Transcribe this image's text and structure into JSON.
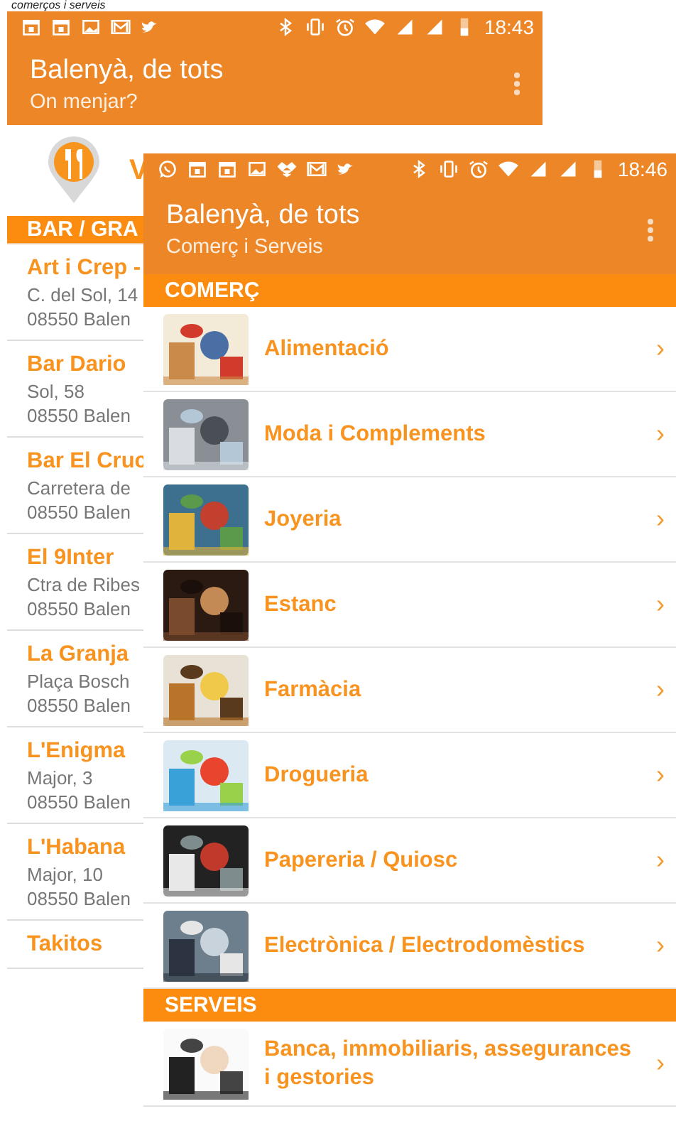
{
  "caption": "comerços i serveis",
  "back_screen": {
    "status_bar": {
      "time": "18:43"
    },
    "app_bar": {
      "title": "Balenyà, de tots",
      "subtitle": "On menjar?"
    },
    "heading": "V",
    "section": "BAR / GRA",
    "places": [
      {
        "name": "Art i Crep -",
        "lines": [
          "C. del Sol, 14",
          "08550 Balen"
        ]
      },
      {
        "name": "Bar Dario",
        "lines": [
          "Sol, 58",
          "08550 Balen"
        ]
      },
      {
        "name": "Bar El Cruc",
        "lines": [
          "Carretera de",
          "08550 Balen"
        ]
      },
      {
        "name": "El 9Inter",
        "lines": [
          "Ctra de Ribes",
          "08550 Balen"
        ]
      },
      {
        "name": "La Granja",
        "lines": [
          "Plaça Bosch",
          "08550 Balen"
        ]
      },
      {
        "name": "L'Enigma",
        "lines": [
          "Major, 3",
          "08550 Balen"
        ]
      },
      {
        "name": "L'Habana",
        "lines": [
          "Major, 10",
          "08550 Balen"
        ]
      },
      {
        "name": "Takitos"
      }
    ]
  },
  "front_screen": {
    "status_bar": {
      "time": "18:46"
    },
    "app_bar": {
      "title": "Balenyà, de tots",
      "subtitle": "Comerç i Serveis"
    },
    "sections": [
      {
        "title": "COMERÇ",
        "items": [
          {
            "label": "Alimentació",
            "chevron": "›"
          },
          {
            "label": "Moda i Complements",
            "chevron": "›"
          },
          {
            "label": "Joyeria",
            "chevron": "›"
          },
          {
            "label": "Estanc",
            "chevron": "›"
          },
          {
            "label": "Farmàcia",
            "chevron": "›"
          },
          {
            "label": "Drogueria",
            "chevron": "›"
          },
          {
            "label": "Papereria / Quiosc",
            "chevron": "›"
          },
          {
            "label": "Electrònica / Electrodomèstics",
            "chevron": "›"
          }
        ]
      },
      {
        "title": "SERVEIS",
        "items": [
          {
            "label": "Banca, immobiliaris, assegurances i gestories",
            "chevron": "›"
          }
        ]
      }
    ]
  }
}
